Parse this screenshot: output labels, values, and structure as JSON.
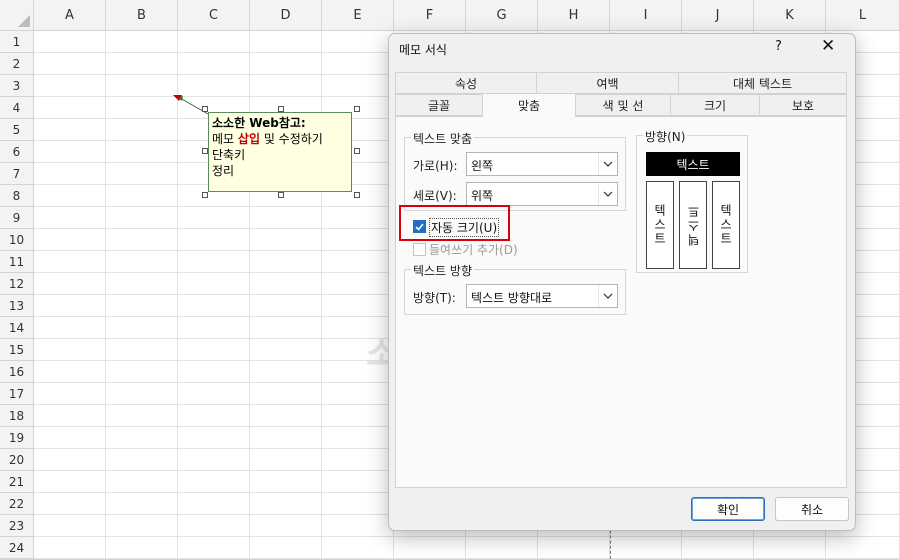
{
  "sheet": {
    "columns": [
      "A",
      "B",
      "C",
      "D",
      "E",
      "F",
      "G",
      "H",
      "I",
      "J",
      "K",
      "L"
    ],
    "rows": [
      "1",
      "2",
      "3",
      "4",
      "5",
      "6",
      "7",
      "8",
      "9",
      "10",
      "11",
      "12",
      "13",
      "14",
      "15",
      "16",
      "17",
      "18",
      "19",
      "20",
      "21",
      "22",
      "23",
      "24"
    ],
    "comment": {
      "title": "소소한 Web참고:",
      "line2_pre": "메모 ",
      "line2_red": "삽입",
      "line2_post": " 및 수정하기",
      "line3": "단축키",
      "line4": "정리"
    },
    "watermark": "소"
  },
  "dialog": {
    "title": "메모 서식",
    "help": "?",
    "close": "✕",
    "tabs_row1": [
      "속성",
      "여백",
      "대체 텍스트"
    ],
    "tabs_row2": [
      "글꼴",
      "맞춤",
      "색 및 선",
      "크기",
      "보호"
    ],
    "text_align": {
      "group_label": "텍스트 맞춤",
      "horizontal_label": "가로(H):",
      "horizontal_value": "왼쪽",
      "vertical_label": "세로(V):",
      "vertical_value": "위쪽"
    },
    "auto_size_label": "자동 크기(U)",
    "rtl_label": "들여쓰기 추가(D)",
    "text_direction": {
      "group_label": "텍스트 방향",
      "direction_label": "방향(T):",
      "direction_value": "텍스트 방향대로"
    },
    "orientation": {
      "group_label": "방향(N)",
      "horizontal": "텍스트",
      "vertical_1": "텍스트",
      "vertical_2": "텍스트",
      "vertical_3": "텍스트"
    },
    "ok": "확인",
    "cancel": "취소"
  },
  "colors": {
    "highlight_box": "#d8000c",
    "accent": "#1f6fc2",
    "comment_bg": "#ffffe1"
  }
}
